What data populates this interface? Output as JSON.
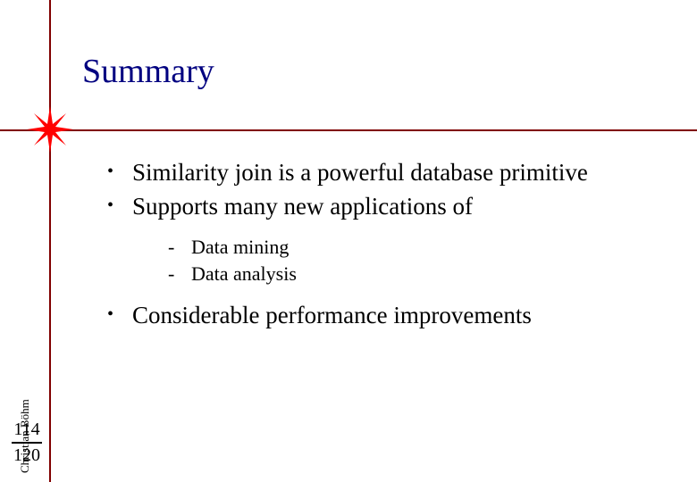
{
  "title": "Summary",
  "bullets": {
    "items": [
      {
        "text": "Similarity join is a powerful database primitive"
      },
      {
        "text": "Supports many new applications of"
      }
    ],
    "sub": [
      {
        "text": "Data mining"
      },
      {
        "text": "Data analysis"
      }
    ],
    "after": [
      {
        "text": "Considerable performance improvements"
      }
    ]
  },
  "author": "Christian Böhm",
  "page": {
    "current": "114",
    "total": "120"
  },
  "glyphs": {
    "bullet1": "•",
    "bullet2": "-"
  },
  "colors": {
    "rule": "#800000",
    "title": "#000080",
    "star": "#FF0000"
  }
}
